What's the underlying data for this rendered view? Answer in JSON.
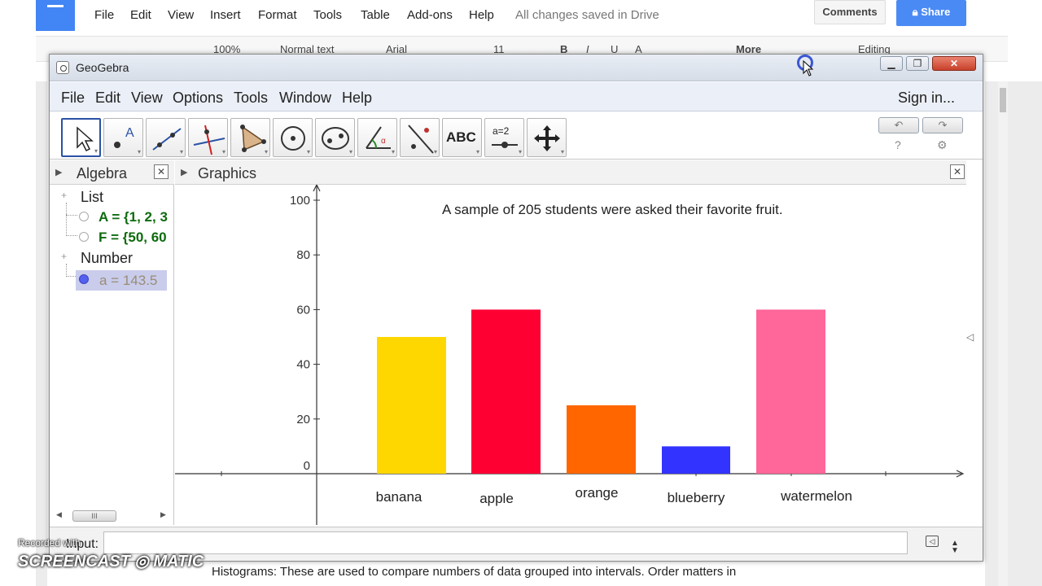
{
  "docs": {
    "menu": [
      "File",
      "Edit",
      "View",
      "Insert",
      "Format",
      "Tools",
      "Table",
      "Add-ons",
      "Help"
    ],
    "saved_status": "All changes saved in Drive",
    "comments_label": "Comments",
    "share_label": "Share",
    "toolbar": {
      "zoom": "100%",
      "style": "Normal text",
      "font": "Arial",
      "size": "11",
      "bold": "B",
      "italic": "I",
      "underline": "U",
      "text_color": "A",
      "more": "More",
      "editing": "Editing"
    },
    "body_text": "Histograms: These are used to compare numbers of data grouped into intervals.  Order matters in"
  },
  "geogebra": {
    "window_title": "GeoGebra",
    "window_buttons": {
      "minimize": "▁",
      "maximize": "❐",
      "close": "✕"
    },
    "menu": [
      "File",
      "Edit",
      "View",
      "Options",
      "Tools",
      "Window",
      "Help"
    ],
    "sign_in": "Sign in...",
    "tools": [
      {
        "name": "move-tool",
        "icon": "move-arrow-icon"
      },
      {
        "name": "point-tool",
        "icon": "point-icon"
      },
      {
        "name": "line-tool",
        "icon": "line-icon"
      },
      {
        "name": "perpendicular-tool",
        "icon": "perpendicular-icon"
      },
      {
        "name": "polygon-tool",
        "icon": "polygon-icon"
      },
      {
        "name": "circle-tool",
        "icon": "circle-icon"
      },
      {
        "name": "ellipse-tool",
        "icon": "ellipse-icon"
      },
      {
        "name": "angle-tool",
        "icon": "angle-icon"
      },
      {
        "name": "reflect-tool",
        "icon": "reflect-icon"
      },
      {
        "name": "text-tool",
        "label": "ABC"
      },
      {
        "name": "slider-tool",
        "label": "a=2"
      },
      {
        "name": "move-view-tool",
        "icon": "move-graphics-icon"
      }
    ],
    "undo_glyph": "↶",
    "redo_glyph": "↷",
    "help_glyph": "?",
    "settings_glyph": "⚙",
    "algebra": {
      "title": "Algebra",
      "groups": [
        {
          "label": "List",
          "items": [
            "A = {1, 2, 3",
            "F = {50, 60"
          ]
        },
        {
          "label": "Number",
          "items": [
            "a = 143.5"
          ]
        }
      ],
      "scroll_glyph": "III"
    },
    "graphics": {
      "title": "Graphics",
      "annotation": "A sample of 205 students were asked their favorite fruit."
    },
    "input_label": "Input:"
  },
  "chart_data": {
    "type": "bar",
    "title": "",
    "annotation": "A sample of 205 students were asked their favorite fruit.",
    "categories": [
      "banana",
      "apple",
      "orange",
      "blueberry",
      "watermelon"
    ],
    "values": [
      50,
      60,
      25,
      10,
      60
    ],
    "colors": [
      "#ffd700",
      "#ff0033",
      "#ff6600",
      "#3333ff",
      "#ff6699"
    ],
    "ylim": [
      0,
      100
    ],
    "yticks": [
      0,
      20,
      40,
      60,
      80,
      100
    ],
    "xlabel": "",
    "ylabel": "",
    "grid": false
  },
  "watermark": {
    "recorded": "Recorded with",
    "logo": "SCREENCAST ◎ MATIC"
  }
}
